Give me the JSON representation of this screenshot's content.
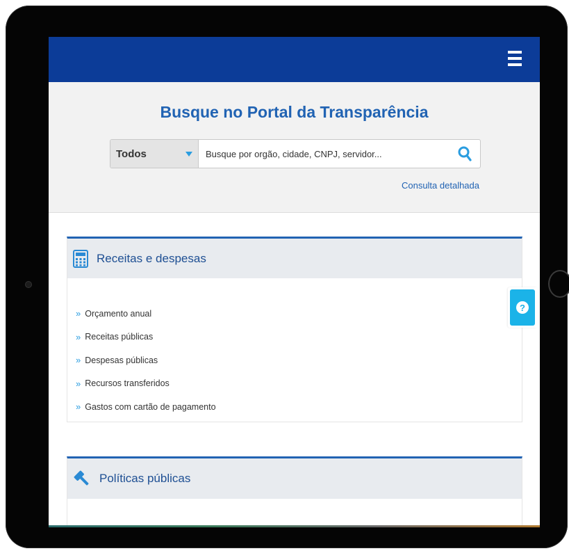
{
  "header": {
    "menu_icon": "hamburger-menu-icon"
  },
  "search": {
    "title": "Busque no Portal da Transparência",
    "scope_selected": "Todos",
    "placeholder": "Busque por orgão, cidade, CNPJ, servidor...",
    "detail_link": "Consulta detalhada"
  },
  "sections": {
    "receitas": {
      "title": "Receitas e despesas",
      "icon": "calculator-icon",
      "items": [
        "Orçamento anual",
        "Receitas públicas",
        "Despesas públicas",
        "Recursos transferidos",
        "Gastos com cartão de pagamento"
      ]
    },
    "politicas": {
      "title": "Políticas públicas",
      "icon": "gavel-icon"
    }
  },
  "help": {
    "icon": "question-mark-icon"
  },
  "colors": {
    "topbar": "#0c3c98",
    "title_blue": "#2163b3",
    "accent": "#2a9de0",
    "help": "#1bb3e8"
  }
}
